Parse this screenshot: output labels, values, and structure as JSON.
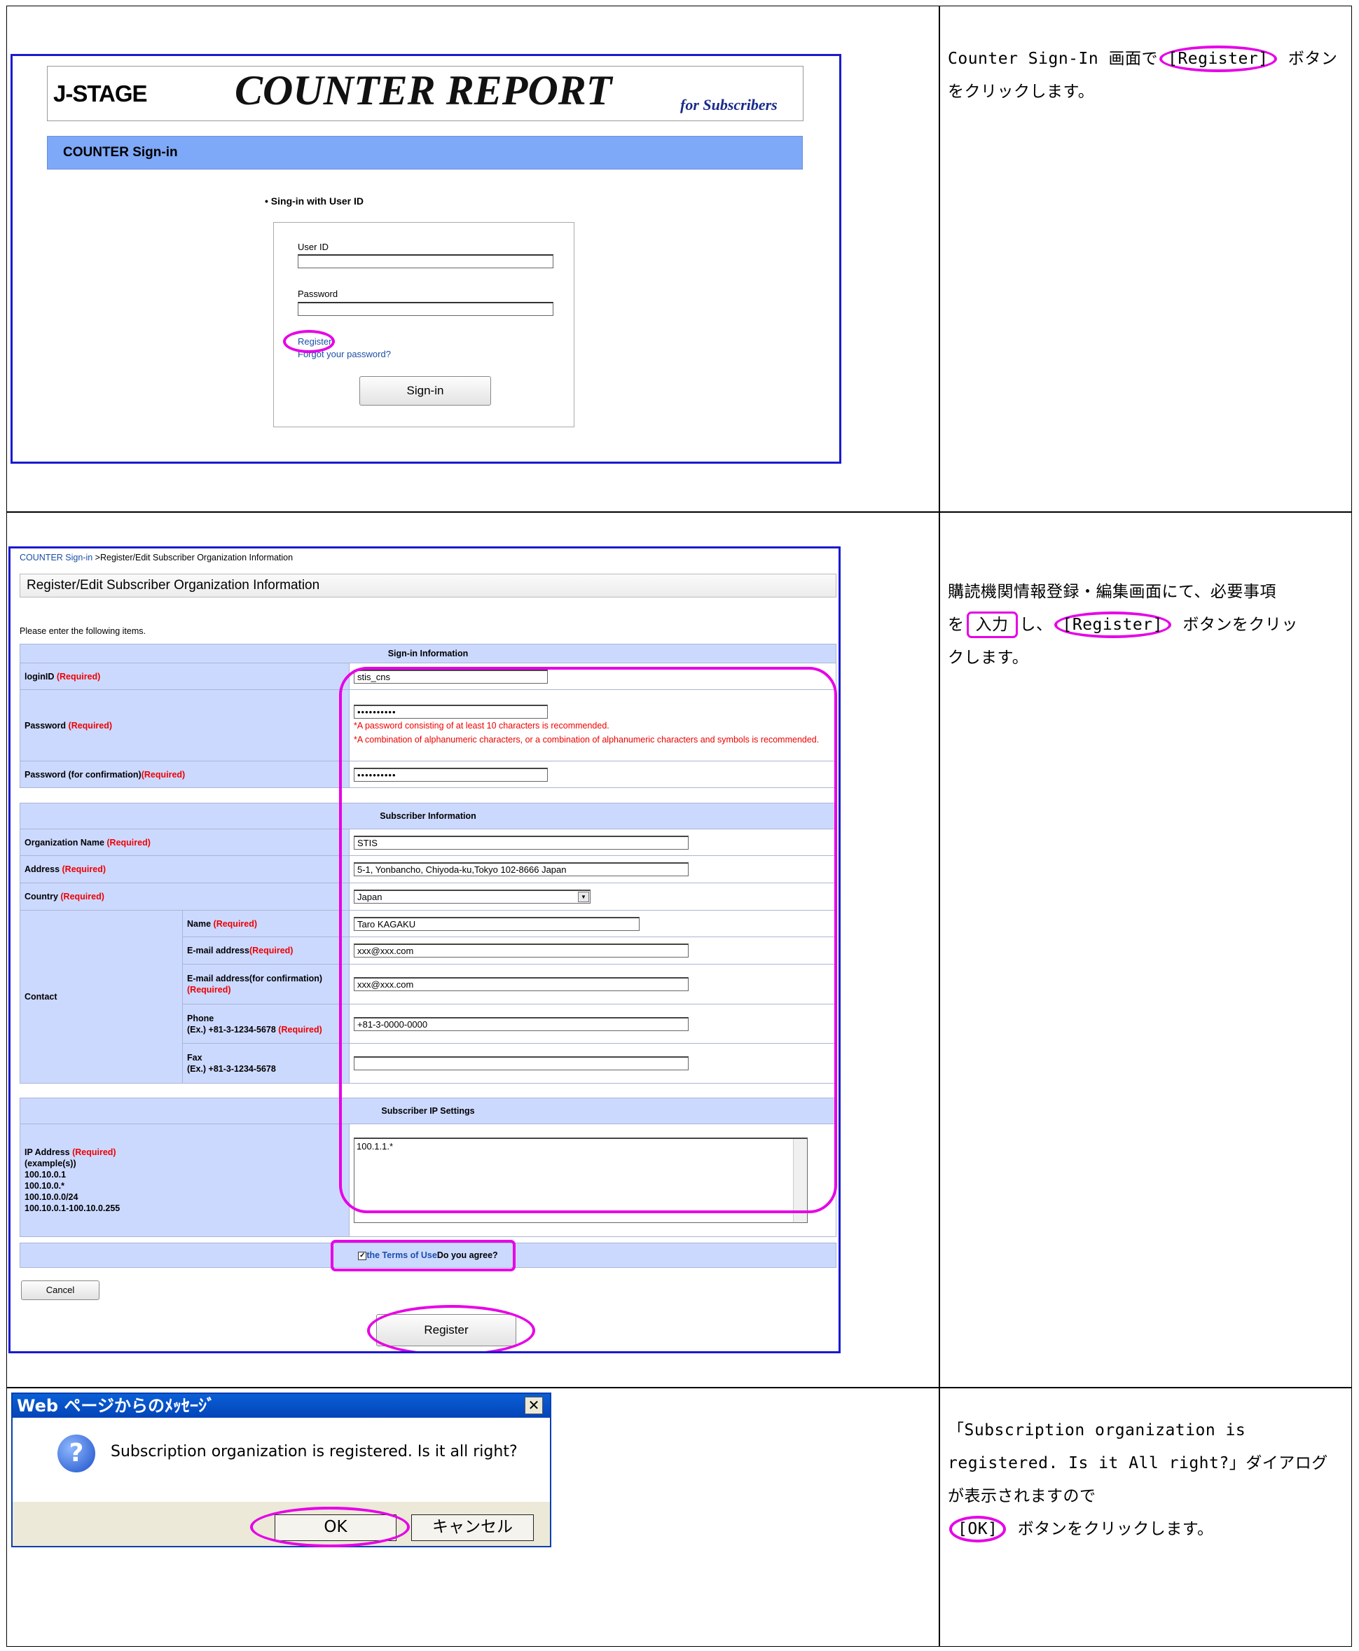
{
  "panel1": {
    "logo": "J-STAGE",
    "title": "COUNTER REPORT",
    "tagline": "for Subscribers",
    "section_bar": "COUNTER Sign-in",
    "signin_heading": "• Sing-in with User ID",
    "userid_label": "User ID",
    "password_label": "Password",
    "register_link": "Register",
    "forgot_link": "Forgot your password?",
    "signin_button": "Sign-in",
    "description": {
      "pre": "Counter Sign-In 画面で",
      "btn": "[Register]",
      "post": " ボタンをクリックします。"
    }
  },
  "panel2": {
    "breadcrumb_link": "COUNTER Sign-in",
    "breadcrumb_rest": " >Register/Edit Subscriber Organization Information",
    "page_title": "Register/Edit Subscriber Organization Information",
    "intro": "Please enter the following items.",
    "required_tag": "(Required)",
    "signin_info": {
      "header": "Sign-in Information",
      "login_label": "loginID ",
      "login_value": "stis_cns",
      "password_label": "Password ",
      "password_value": "••••••••••",
      "password_note1": "*A password consisting of at least 10 characters is recommended.",
      "password_note2": "*A combination of alphanumeric characters, or a combination of alphanumeric characters and symbols is recommended.",
      "confirm_label": "Password (for confirmation)",
      "confirm_value": "••••••••••"
    },
    "subscriber_info": {
      "header": "Subscriber Information",
      "org_label": "Organization Name ",
      "org_value": "STIS",
      "address_label": "Address ",
      "address_value": "5-1, Yonbancho, Chiyoda-ku,Tokyo 102-8666 Japan",
      "country_label": "Country ",
      "country_value": "Japan",
      "contact_label": "Contact",
      "name_label": "Name ",
      "name_value": "Taro KAGAKU",
      "email_label": "E-mail address",
      "email_value": "xxx@xxx.com",
      "email_confirm_label": "E-mail address(for confirmation)",
      "email_confirm_value": "xxx@xxx.com",
      "phone_label": "Phone",
      "phone_example": "(Ex.) +81-3-1234-5678 ",
      "phone_value": "+81-3-0000-0000",
      "fax_label": "Fax",
      "fax_example": "(Ex.) +81-3-1234-5678",
      "fax_value": ""
    },
    "ip_settings": {
      "header": "Subscriber IP Settings",
      "ip_label": "IP Address ",
      "examples_label": "(example(s))",
      "ex1": "100.10.0.1",
      "ex2": "100.10.0.*",
      "ex3": "100.10.0.0/24",
      "ex4": "100.10.0.1-100.10.0.255",
      "ip_value": "100.1.1.*"
    },
    "terms_link": "the Terms of Use",
    "terms_question": "Do you agree?",
    "cancel_button": "Cancel",
    "register_button": "Register",
    "description": {
      "l1": "購読機関情報登録・編集画面にて、必要事項",
      "pre": "を",
      "box": "入力",
      "mid": "し、",
      "btn": "[Register]",
      "post": " ボタンをクリッ",
      "l3": "クします。"
    }
  },
  "panel3": {
    "dialog_title": "Web ページからのﾒｯｾｰｼﾞ",
    "close_glyph": "✕",
    "question_glyph": "?",
    "message": "Subscription organization is registered. Is it all right?",
    "ok_button": "OK",
    "cancel_button": "キャンセル",
    "description": {
      "l1": "「Subscription organization is",
      "l2": "registered. Is it All right?」ダイアログ",
      "l3": "が表示されますので",
      "btn": "[OK]",
      "post": " ボタンをクリックします。"
    }
  }
}
